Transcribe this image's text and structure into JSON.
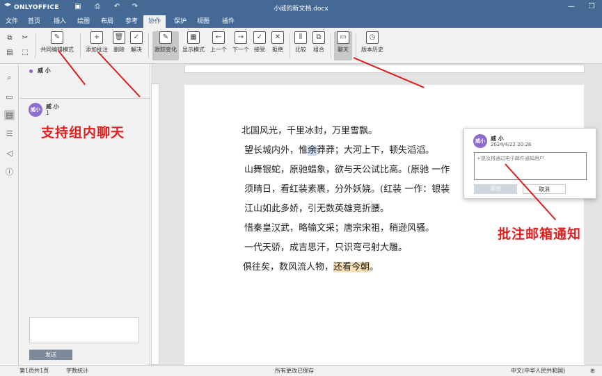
{
  "app": {
    "logo": "ONLYOFFICE",
    "doc_title": "小威的新文档.docx"
  },
  "tabs": [
    {
      "label": "文件"
    },
    {
      "label": "首页"
    },
    {
      "label": "插入"
    },
    {
      "label": "绘图"
    },
    {
      "label": "布局"
    },
    {
      "label": "参考"
    },
    {
      "label": "协作"
    },
    {
      "label": "保护"
    },
    {
      "label": "视图"
    },
    {
      "label": "插件"
    }
  ],
  "toolbar": {
    "coedit": "共同编辑模式",
    "add_comment": "添加批注",
    "delete": "删除",
    "resolve": "解决",
    "track": "跟踪变化",
    "display": "显示模式",
    "prev": "上一个",
    "next": "下一个",
    "accept": "接受",
    "reject": "拒绝",
    "compare": "比较",
    "combine": "组合",
    "chat": "聊天",
    "history": "版本历史"
  },
  "chat": {
    "online_user": "威 小",
    "message_user": "威 小",
    "message_text": "1",
    "avatar": "威小",
    "send": "发送"
  },
  "document": {
    "lines": [
      "北国风光，千里冰封，万里雪飘。",
      "望长城内外，惟",
      "余",
      "莽莽；大河上下，顿失滔滔。",
      "山舞银蛇，原驰蜡象，欲与天公试比高。(原驰 一作",
      "须晴日，看红装素裹，分外妖娆。(红装 一作：银装",
      "江山如此多娇，引无数英雄竞折腰。",
      "惜秦皇汉武，略输文采；唐宗宋祖，稍逊风骚。",
      "一代天骄，成吉思汗，只识弯弓射大雕。",
      "俱往矣，数风流人物，",
      "还看今朝",
      "。"
    ]
  },
  "comment": {
    "user": "威 小",
    "avatar": "威小",
    "date": "2024/4/22 20:28",
    "placeholder": "+提及将通过电子邮件通知用户",
    "add": "添加",
    "cancel": "取消"
  },
  "annotations": {
    "chat": "支持组内聊天",
    "email": "批注邮箱通知"
  },
  "status": {
    "page": "第1页共1页",
    "word_count": "字数统计",
    "saved": "所有更改已保存",
    "language": "中文(中华人民共和国)"
  }
}
